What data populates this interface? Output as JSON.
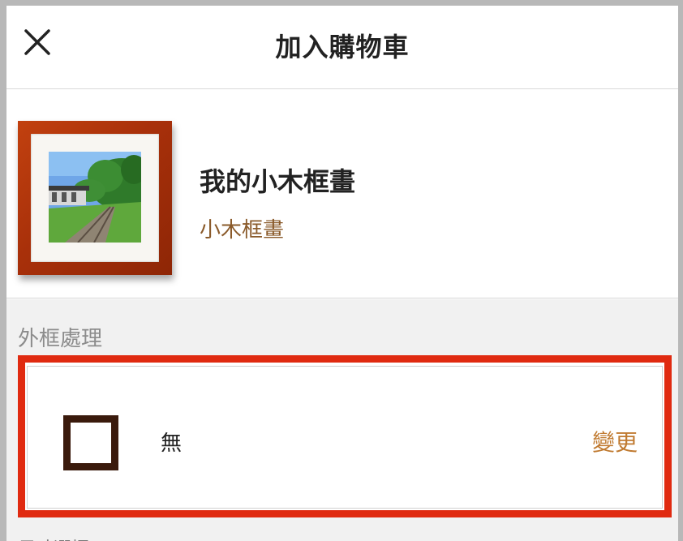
{
  "header": {
    "title": "加入購物車",
    "close_icon": "close-icon"
  },
  "product": {
    "name": "我的小木框畫",
    "subtitle": "小木框畫",
    "frame_color": "#b3360c"
  },
  "frame_section": {
    "label": "外框處理",
    "selected_option": "無",
    "change_label": "變更",
    "highlight_color": "#e02a10",
    "swatch_color": "#3a1a0c"
  },
  "footer": {
    "peek_text": "尺寸選擇"
  }
}
